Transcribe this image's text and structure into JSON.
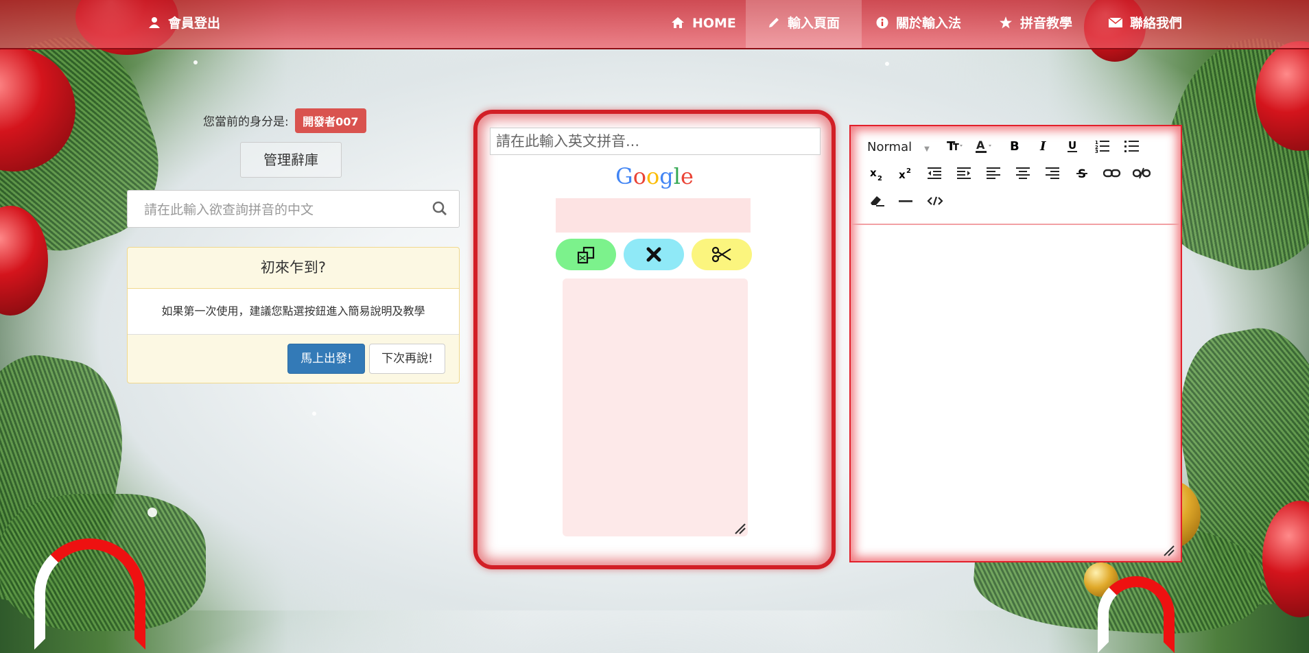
{
  "navbar": {
    "logout_label": "會員登出",
    "items": [
      {
        "label": "HOME",
        "icon": "home-icon"
      },
      {
        "label": "輸入頁面",
        "icon": "pencil-icon",
        "active": true
      },
      {
        "label": "關於輸入法",
        "icon": "info-icon"
      },
      {
        "label": "拼音教學",
        "icon": "star-icon"
      },
      {
        "label": "聯絡我們",
        "icon": "envelope-icon"
      }
    ]
  },
  "identity": {
    "prefix": "您當前的身分是:",
    "role": "開發者007",
    "badge_color": "#d9534f"
  },
  "manage_button": "管理辭庫",
  "lookup": {
    "placeholder": "請在此輸入欲查詢拼音的中文",
    "value": ""
  },
  "welcome_panel": {
    "heading": "初來乍到?",
    "body": "如果第一次使用，建議您點選按鈕進入簡易說明及教學",
    "primary_button": "馬上出發!",
    "secondary_button": "下次再說!"
  },
  "ime": {
    "placeholder": "請在此輸入英文拼音...",
    "value": "",
    "logo_text": "Google",
    "border_color": "#d21f26",
    "buttons": [
      {
        "icon": "copy-icon",
        "color": "#7cf28c"
      },
      {
        "icon": "close-icon",
        "color": "#8fe9f7"
      },
      {
        "icon": "scissors-icon",
        "color": "#fbf57e"
      }
    ],
    "output_text": ""
  },
  "editor": {
    "format_label": "Normal",
    "border_color": "#e21f2a",
    "tools": [
      "font-size-icon",
      "font-color-icon",
      "bold-icon",
      "italic-icon",
      "underline-icon",
      "ordered-list-icon",
      "bullet-list-icon",
      "subscript-icon",
      "superscript-icon",
      "outdent-icon",
      "indent-icon",
      "align-left-icon",
      "align-center-icon",
      "align-right-icon",
      "strikethrough-icon",
      "link-icon",
      "unlink-icon",
      "clear-format-icon",
      "horizontal-rule-icon",
      "code-view-icon"
    ],
    "content": ""
  }
}
